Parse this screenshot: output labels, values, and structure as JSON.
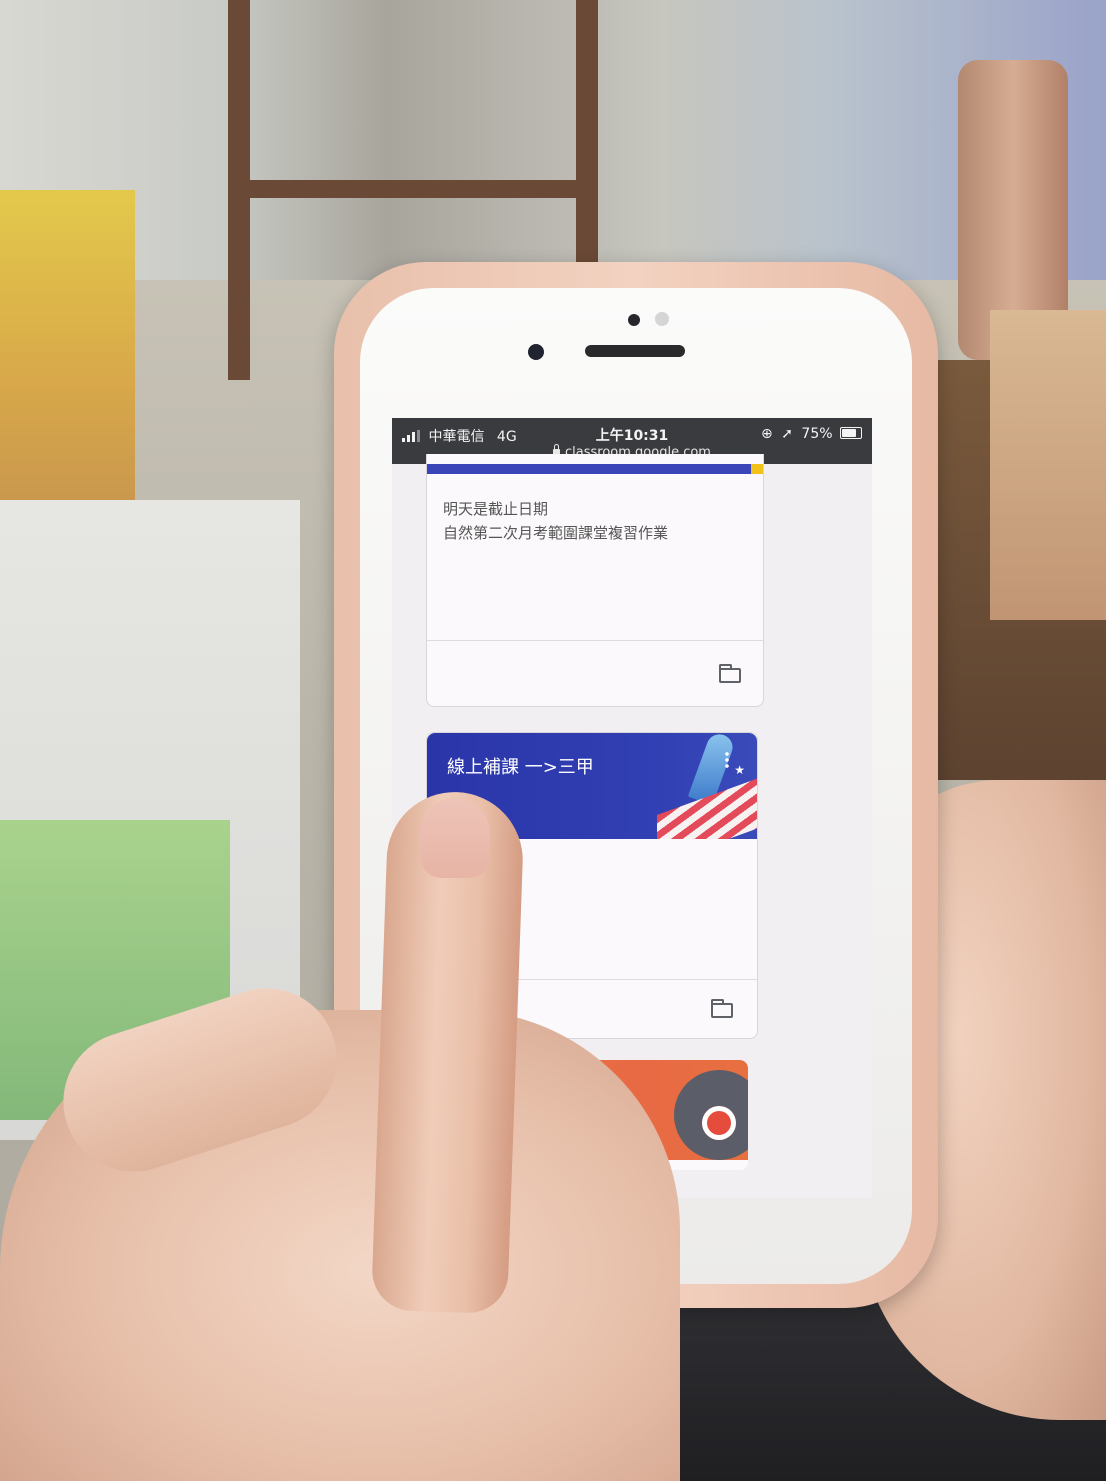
{
  "status_bar": {
    "carrier": "中華電信",
    "network": "4G",
    "time": "上午10:31",
    "url": "classroom.google.com",
    "battery": "75%"
  },
  "cards": [
    {
      "due_text": "明天是截止日期",
      "assignment": "自然第二次月考範圍課堂複習作業",
      "icon": "folder-icon"
    },
    {
      "title": "線上補課 一>三甲",
      "icon": "folder-icon",
      "banner_color": "#2f3db1"
    },
    {
      "banner_color": "#e86f45"
    }
  ]
}
